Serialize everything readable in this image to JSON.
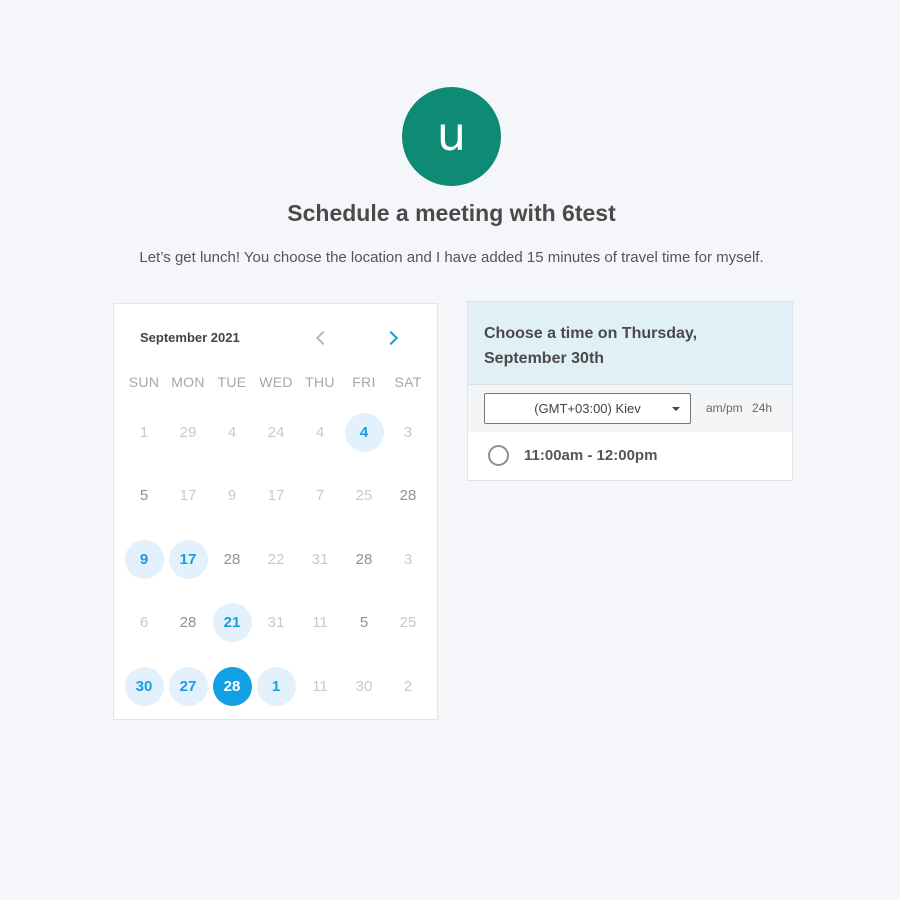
{
  "avatar": {
    "initial": "u",
    "color": "#0e8a75"
  },
  "header": {
    "title": "Schedule a meeting with 6test",
    "subtitle": "Let’s get lunch! You choose the location and I have added 15 minutes of travel time for myself."
  },
  "calendar": {
    "month_label": "September 2021",
    "prev_icon": "chevron-left-icon",
    "next_icon": "chevron-right-icon",
    "weekdays": [
      "SUN",
      "MON",
      "TUE",
      "WED",
      "THU",
      "FRI",
      "SAT"
    ],
    "weeks": [
      [
        {
          "d": "1",
          "s": "muted"
        },
        {
          "d": "29",
          "s": "muted"
        },
        {
          "d": "4",
          "s": "muted"
        },
        {
          "d": "24",
          "s": "muted"
        },
        {
          "d": "4",
          "s": "muted"
        },
        {
          "d": "4",
          "s": "avail"
        },
        {
          "d": "3",
          "s": "muted"
        }
      ],
      [
        {
          "d": "5",
          "s": "dark"
        },
        {
          "d": "17",
          "s": "muted"
        },
        {
          "d": "9",
          "s": "muted"
        },
        {
          "d": "17",
          "s": "muted"
        },
        {
          "d": "7",
          "s": "muted"
        },
        {
          "d": "25",
          "s": "muted"
        },
        {
          "d": "28",
          "s": "dark"
        }
      ],
      [
        {
          "d": "9",
          "s": "avail"
        },
        {
          "d": "17",
          "s": "avail"
        },
        {
          "d": "28",
          "s": "dark"
        },
        {
          "d": "22",
          "s": "muted"
        },
        {
          "d": "31",
          "s": "muted"
        },
        {
          "d": "28",
          "s": "dark"
        },
        {
          "d": "3",
          "s": "muted"
        }
      ],
      [
        {
          "d": "6",
          "s": "muted"
        },
        {
          "d": "28",
          "s": "dark"
        },
        {
          "d": "21",
          "s": "avail"
        },
        {
          "d": "31",
          "s": "muted"
        },
        {
          "d": "11",
          "s": "muted"
        },
        {
          "d": "5",
          "s": "dark"
        },
        {
          "d": "25",
          "s": "muted"
        }
      ],
      [
        {
          "d": "30",
          "s": "avail"
        },
        {
          "d": "27",
          "s": "avail"
        },
        {
          "d": "28",
          "s": "sel"
        },
        {
          "d": "1",
          "s": "avail"
        },
        {
          "d": "11",
          "s": "muted"
        },
        {
          "d": "30",
          "s": "muted"
        },
        {
          "d": "2",
          "s": "muted"
        }
      ]
    ],
    "colors": {
      "available_bg": "#e2f1fb",
      "available_text": "#1a9ddb",
      "selected_bg": "#11a0e4"
    }
  },
  "times": {
    "heading_line1": "Choose a time on Thursday,",
    "heading_line2": "September 30th",
    "timezone": "(GMT+03:00) Kiev",
    "format_ampm": "am/pm",
    "format_24h": "24h",
    "slots": [
      "11:00am - 12:00pm"
    ]
  }
}
